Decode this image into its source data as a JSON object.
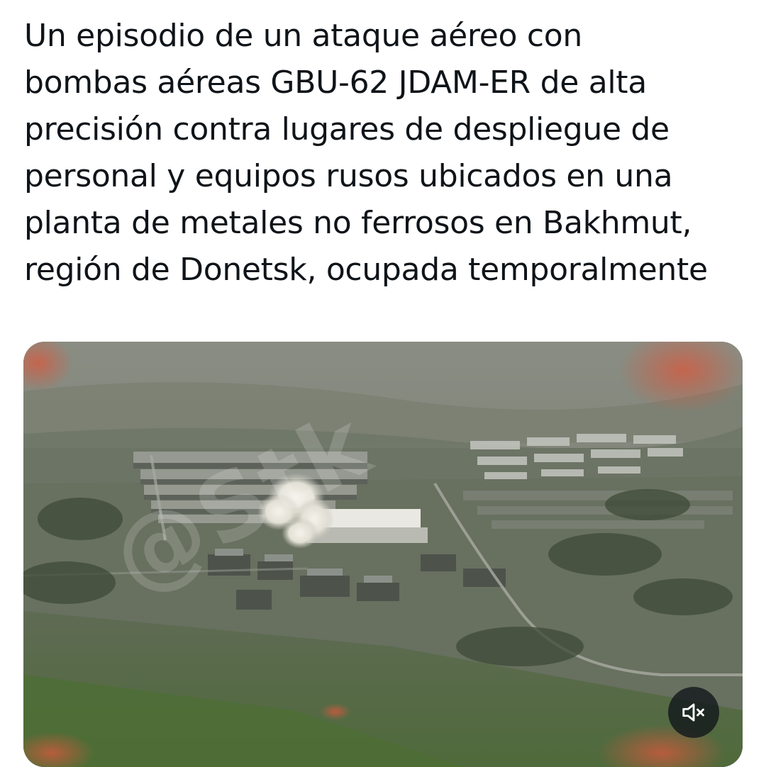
{
  "post": {
    "text_lines": [
      "Un episodio de un ataque aéreo con",
      "bombas aéreas GBU-62 JDAM-ER de alta",
      "precisión contra lugares de despliegue de",
      "personal y equipos rusos ubicados en una",
      "planta de metales no ferrosos en Bakhmut,",
      "región de Donetsk, ocupada temporalmente"
    ]
  },
  "media": {
    "type": "video",
    "watermark": "@Stk",
    "mute_icon": "speaker-muted-icon"
  },
  "colors": {
    "text": "#0f1419",
    "background": "#ffffff",
    "control_bg": "#0f1419",
    "control_fg": "#ffffff"
  }
}
